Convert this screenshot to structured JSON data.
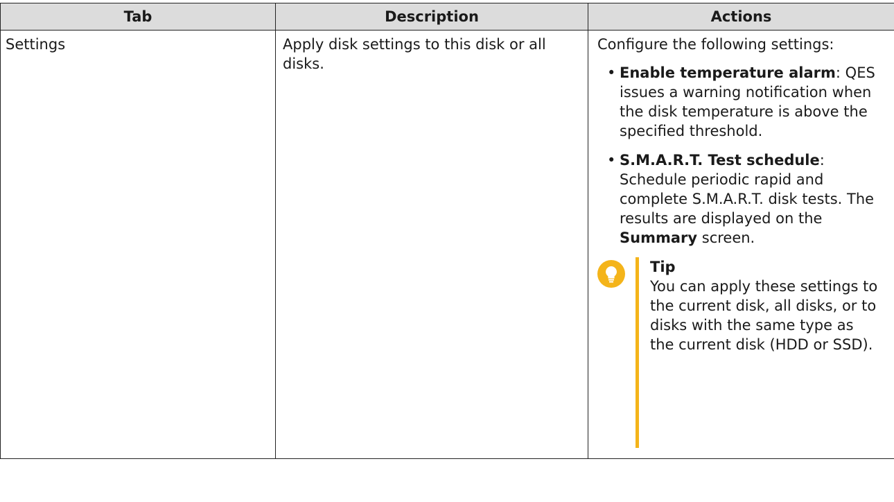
{
  "table": {
    "headers": [
      "Tab",
      "Description",
      "Actions"
    ],
    "row": {
      "tab": "Settings",
      "description": "Apply disk settings to this disk or all disks.",
      "actions": {
        "intro": "Configure the following settings:",
        "items": [
          {
            "term": "Enable temperature alarm",
            "text": "QES issues a warning notification when the disk temperature is above the specified threshold."
          },
          {
            "term": "S.M.A.R.T. Test schedule",
            "text": "Schedule periodic rapid and complete S.M.A.R.T. disk tests. The results are displayed on the",
            "emphasis": "Summary",
            "tail": "screen."
          }
        ],
        "tip": {
          "icon": "lightbulb-icon",
          "title": "Tip",
          "text": "You can apply these settings to the current disk, all disks, or to disks with the same type as the current disk (HDD or SSD).",
          "accent_color": "#f4b41a"
        }
      }
    }
  }
}
